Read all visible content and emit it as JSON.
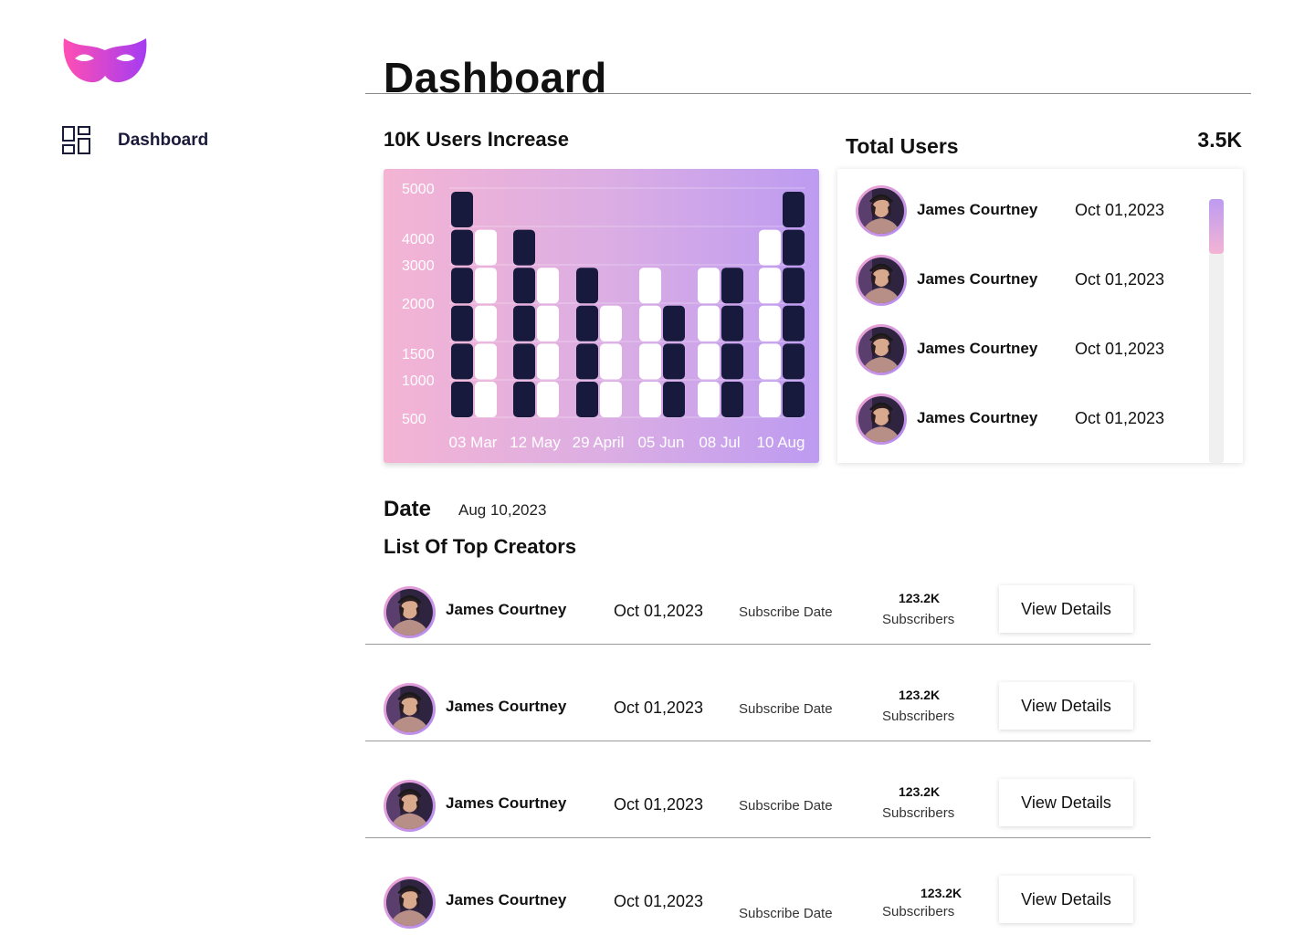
{
  "app": {
    "logo_icon": "mask-icon",
    "brand_gradient": [
      "#ff4fb3",
      "#a43cf2"
    ]
  },
  "sidebar": {
    "items": [
      {
        "label": "Dashboard",
        "icon": "grid-layout-icon"
      }
    ]
  },
  "header": {
    "title": "Dashboard"
  },
  "chart_section": {
    "title": "10K Users Increase"
  },
  "chart_data": {
    "type": "bar",
    "title": "10K Users Increase",
    "categories": [
      "03 Mar",
      "12 May",
      "29 April",
      "05 Jun",
      "08 Jul",
      "10 Aug"
    ],
    "y_ticks": [
      5000,
      4000,
      3000,
      2000,
      1500,
      1000,
      500
    ],
    "series": [
      {
        "color": "#171a3d",
        "values": [
          5000,
          4000,
          3000,
          2000,
          3000,
          5000
        ]
      },
      {
        "color": "#ffffff",
        "values": [
          4000,
          3000,
          2000,
          3000,
          3000,
          4000
        ]
      }
    ],
    "grid": true,
    "background_gradient": [
      "#f4b4d4",
      "#bd9bf1"
    ]
  },
  "total_users": {
    "title": "Total Users",
    "total": "3.5K",
    "items": [
      {
        "name": "James Courtney",
        "date": "Oct 01,2023"
      },
      {
        "name": "James Courtney",
        "date": "Oct 01,2023"
      },
      {
        "name": "James Courtney",
        "date": "Oct 01,2023"
      },
      {
        "name": "James Courtney",
        "date": "Oct 01,2023"
      }
    ]
  },
  "date_section": {
    "label": "Date",
    "value": "Aug 10,2023"
  },
  "top_creators": {
    "title": "List Of Top Creators",
    "rows": [
      {
        "name": "James Courtney",
        "date": "Oct 01,2023",
        "date_label": "Subscribe Date",
        "subscribers": "123.2K",
        "subscribers_label": "Subscribers",
        "action": "View Details"
      },
      {
        "name": "James Courtney",
        "date": "Oct 01,2023",
        "date_label": "Subscribe Date",
        "subscribers": "123.2K",
        "subscribers_label": "Subscribers",
        "action": "View Details"
      },
      {
        "name": "James Courtney",
        "date": "Oct 01,2023",
        "date_label": "Subscribe Date",
        "subscribers": "123.2K",
        "subscribers_label": "Subscribers",
        "action": "View Details"
      },
      {
        "name": "James Courtney",
        "date": "Oct 01,2023",
        "date_label": "Subscribe Date",
        "subscribers": "123.2K",
        "subscribers_label": "Subscribers",
        "action": "View Details"
      }
    ]
  }
}
